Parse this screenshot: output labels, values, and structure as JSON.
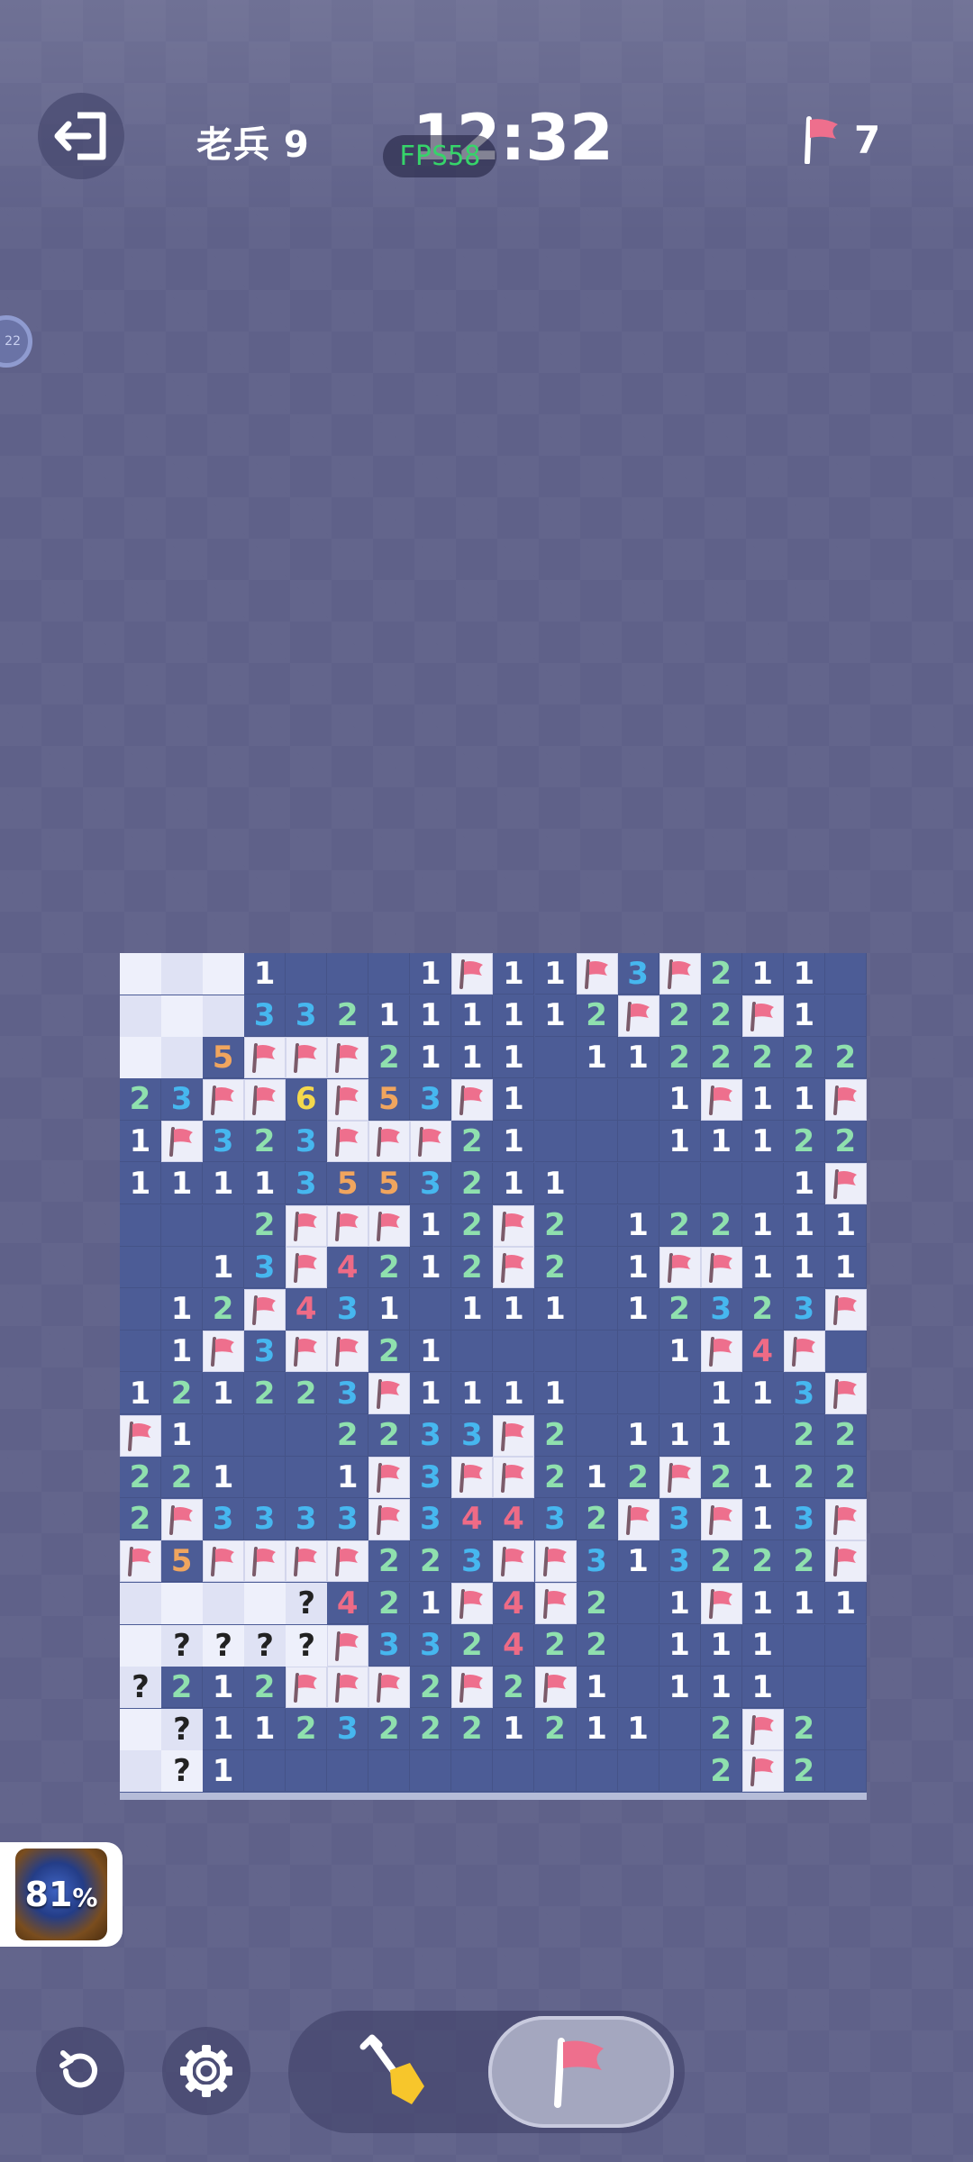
{
  "header": {
    "rank_label": "老兵 9",
    "timer": "12:32",
    "fps_label": "FPS58",
    "flags_remaining": "7"
  },
  "side_badge": {
    "text": "22"
  },
  "progress": {
    "percent_value": "81",
    "percent_sign": "%"
  },
  "colors": {
    "board_bg": "#4c5c96",
    "hidden_a": "#eef0fb",
    "hidden_b": "#dfe2f4",
    "flag_red": "#ee6f8d",
    "n1": "#ffffff",
    "n2": "#8fe0ae",
    "n3": "#46b7ef",
    "n4": "#ee6b86",
    "n5": "#f0a55e",
    "n6": "#f4d84c"
  },
  "icons": {
    "exit": "exit-icon",
    "flag": "flag-icon",
    "restart": "restart-icon",
    "settings": "gear-icon",
    "dig": "shovel-icon"
  },
  "board": {
    "cols": 18,
    "rows": 20,
    "legend": "H=hidden, F=flag, ?=question, 0=revealed empty, 1-8=number",
    "grid": [
      "HHH10001F11F3F2110",
      "HHH332111112F22F10",
      "HH5FFF2111011222221",
      "23FF6F53F10001F11F",
      "1F323FFF210001112 2",
      "11113553211000001F",
      "0002FFF12F201221 11",
      "0013F42 12F201FF111",
      "012F431011101232 3F",
      "01F3FF21000001F4F",
      "121223F1111000113F",
      "F1000223 3F20111022",
      "221001F3FF212F2122F",
      "2F3333F3443 2F3F13F",
      "F5FFFF22 3FF31 32 22F",
      "HHHH?42 1F4F20 1F111",
      "H????F3324220 111 00",
      "?212FFF2F2F10111 00",
      "H?1123222 12110 2F2 0",
      "H?100000000000 2F2 0"
    ]
  }
}
